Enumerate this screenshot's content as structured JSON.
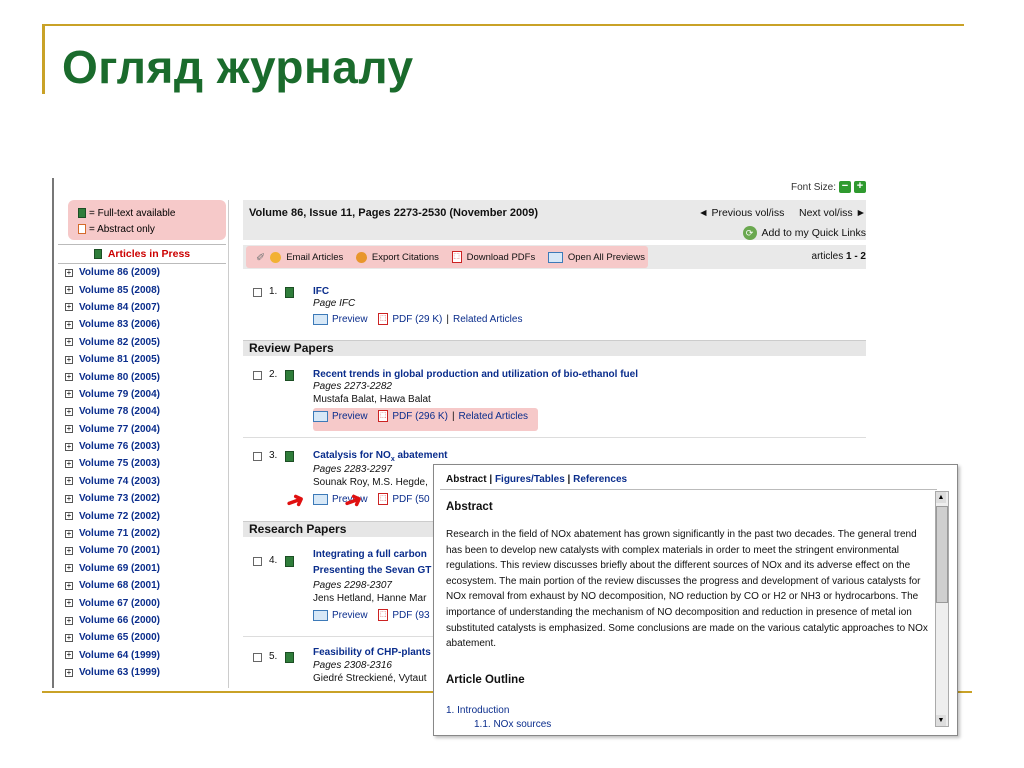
{
  "slide": {
    "title": "Огляд журналу"
  },
  "font_size": {
    "label": "Font Size:",
    "minus": "−",
    "plus": "+"
  },
  "legend": {
    "full_text": "= Full-text available",
    "abstract_only": "= Abstract only"
  },
  "sidebar": {
    "articles_in_press": "Articles in Press",
    "volumes": [
      "Volume 86 (2009)",
      "Volume 85 (2008)",
      "Volume 84 (2007)",
      "Volume 83 (2006)",
      "Volume 82 (2005)",
      "Volume 81 (2005)",
      "Volume 80 (2005)",
      "Volume 79 (2004)",
      "Volume 78 (2004)",
      "Volume 77 (2004)",
      "Volume 76 (2003)",
      "Volume 75 (2003)",
      "Volume 74 (2003)",
      "Volume 73 (2002)",
      "Volume 72 (2002)",
      "Volume 71 (2002)",
      "Volume 70 (2001)",
      "Volume 69 (2001)",
      "Volume 68 (2001)",
      "Volume 67 (2000)",
      "Volume 66 (2000)",
      "Volume 65 (2000)",
      "Volume 64 (1999)",
      "Volume 63 (1999)"
    ]
  },
  "header": {
    "volume_title": "Volume 86, Issue 11, Pages 2273-2530 (November 2009)",
    "prev": "◄ Previous vol/iss",
    "next": "Next vol/iss ►",
    "quick_links": "Add to my Quick Links"
  },
  "toolbar": {
    "email": "Email Articles",
    "export": "Export Citations",
    "download": "Download PDFs",
    "previews": "Open All Previews",
    "count_prefix": "articles ",
    "count": "1 - 2"
  },
  "sections": {
    "review": "Review Papers",
    "research": "Research Papers"
  },
  "articles": [
    {
      "num": "1.",
      "title": "IFC",
      "pages": "Page IFC",
      "authors": "",
      "preview": "Preview",
      "pdf": "PDF (29 K)",
      "sep": " | ",
      "related": "Related Articles"
    },
    {
      "num": "2.",
      "title": "Recent trends in global production and utilization of bio-ethanol fuel",
      "pages": "Pages 2273-2282",
      "authors": "Mustafa Balat, Hawa Balat",
      "preview": "Preview",
      "pdf": "PDF (296 K)",
      "sep": " | ",
      "related": "Related Articles"
    },
    {
      "num": "3.",
      "title_pre": "Catalysis for NO",
      "title_sub": "x",
      "title_post": " abatement",
      "pages": "Pages 2283-2297",
      "authors": "Sounak Roy, M.S. Hegde,",
      "preview": "Preview",
      "pdf": "PDF (50"
    },
    {
      "num": "4.",
      "title": "Integrating a full carbon",
      "title2": "Presenting the Sevan GT",
      "pages": "Pages 2298-2307",
      "authors": "Jens Hetland, Hanne Mar",
      "preview": "Preview",
      "pdf": "PDF (93"
    },
    {
      "num": "5.",
      "title": "Feasibility of CHP-plants",
      "pages": "Pages 2308-2316",
      "authors": "Giedré Streckiené, Vytaut"
    }
  ],
  "popup": {
    "tab_abstract": "Abstract",
    "tab_figures": "Figures/Tables",
    "tab_refs": "References",
    "tab_sep": " | ",
    "abstract_heading": "Abstract",
    "abstract_text": "Research in the field of NOx abatement has grown significantly in the past two decades. The general trend has been to develop new catalysts with complex materials in order to meet the stringent environmental regulations. This review discusses briefly about the different sources of NOx and its adverse effect on the ecosystem. The main portion of the review discusses the progress and development of various catalysts for NOx removal from exhaust by NO decomposition, NO reduction by CO or H2 or NH3 or hydrocarbons. The importance of understanding the mechanism of NO decomposition and reduction in presence of metal ion substituted catalysts is emphasized. Some conclusions are made on the various catalytic approaches to NOx abatement.",
    "outline_heading": "Article Outline",
    "outline_1": "1. Introduction",
    "outline_1_1": "1.1. NOx sources"
  },
  "colors": {
    "title_green": "#1a6b2c",
    "accent_gold": "#c9a227",
    "link_blue": "#0a2d8c",
    "highlight_pink": "#f6c9c9",
    "red": "#cc0000"
  }
}
